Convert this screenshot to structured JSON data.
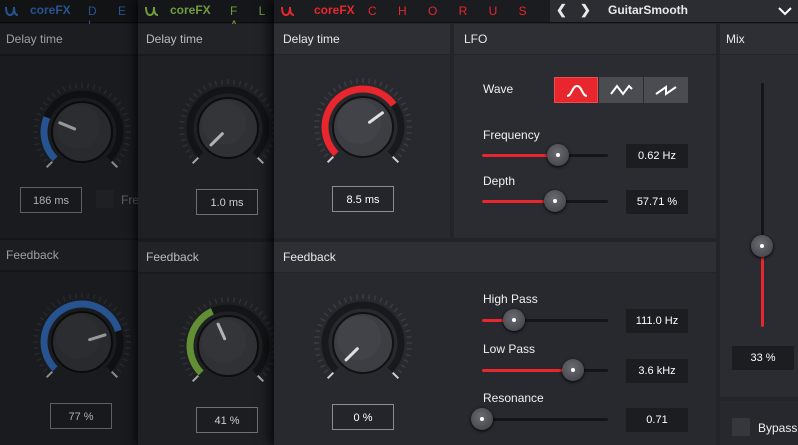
{
  "apps": [
    {
      "brand": "coreFX",
      "name": "D E L",
      "brand_color": "#3a7bd5",
      "name_color": "#3a7bd5"
    },
    {
      "brand": "coreFX",
      "name": "F L A",
      "brand_color": "#8bc34a",
      "name_color": "#8bc34a"
    },
    {
      "brand": "coreFX",
      "name": "C H O R U S",
      "brand_color": "#e8262d",
      "name_color": "#e8262d"
    }
  ],
  "preset": {
    "name": "GuitarSmooth",
    "prev_icon": "chevron-left-icon",
    "next_icon": "chevron-right-icon",
    "dropdown_icon": "chevron-down-icon"
  },
  "delay_plugin": {
    "delay_label": "Delay time",
    "delay_value": "186 ms",
    "delay_level": 0.25,
    "free_label": "Fre",
    "feedback_label": "Feedback",
    "feedback_value": "77 %",
    "feedback_level": 0.77,
    "accent": "#3a7bd5"
  },
  "flanger_plugin": {
    "delay_label": "Delay time",
    "delay_value": "1.0 ms",
    "delay_level": 0.0,
    "feedback_label": "Feedback",
    "feedback_value": "41 %",
    "feedback_level": 0.41,
    "accent": "#7cb342"
  },
  "chorus_plugin": {
    "delay_label": "Delay time",
    "delay_value": "8.5 ms",
    "delay_level": 0.7,
    "feedback_label": "Feedback",
    "feedback_value": "0 %",
    "feedback_level": 0.0,
    "accent": "#e8262d",
    "lfo": {
      "title": "LFO",
      "wave_label": "Wave",
      "waves": [
        "sine-wave-icon",
        "triangle-wave-icon",
        "sawtooth-wave-icon"
      ],
      "selected_wave": 0,
      "frequency_label": "Frequency",
      "frequency_value": "0.62 Hz",
      "frequency_level": 0.6,
      "depth_label": "Depth",
      "depth_value": "57.71 %",
      "depth_level": 0.5771
    },
    "filters": {
      "high_pass_label": "High Pass",
      "high_pass_value": "111.0 Hz",
      "high_pass_level": 0.25,
      "low_pass_label": "Low Pass",
      "low_pass_value": "3.6 kHz",
      "low_pass_level": 0.72,
      "resonance_label": "Resonance",
      "resonance_value": "0.71",
      "resonance_level": 0.0
    },
    "mix_label": "Mix",
    "mix_value": "33 %",
    "mix_level": 0.33,
    "bypass_label": "Bypass"
  }
}
